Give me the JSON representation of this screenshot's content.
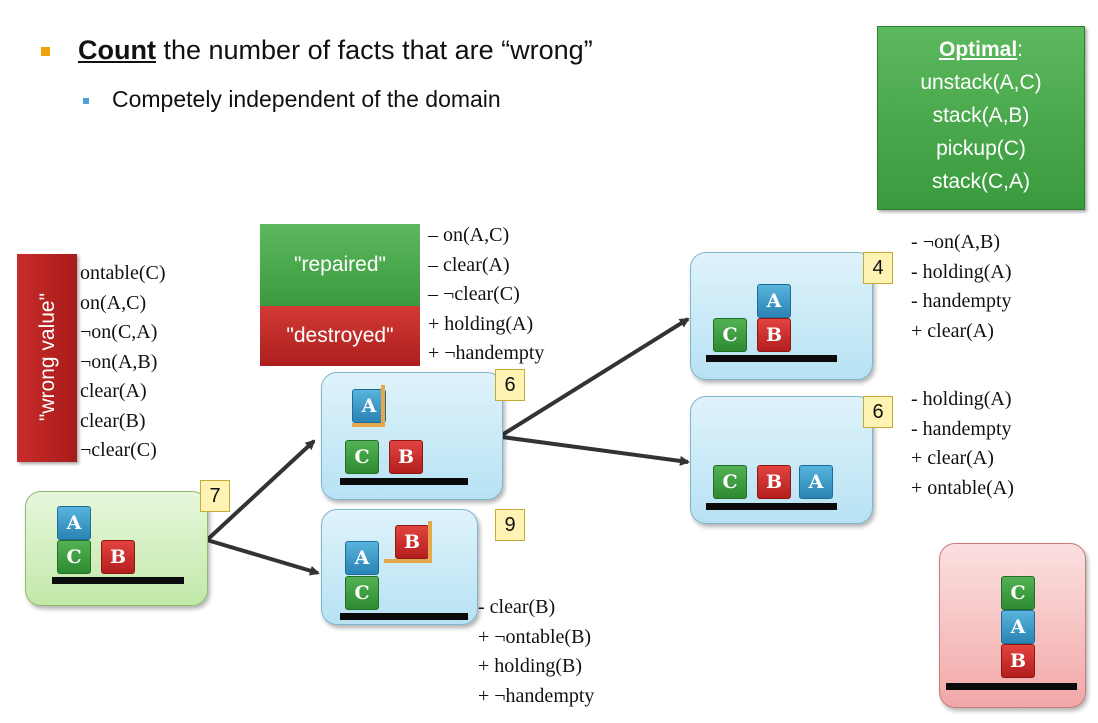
{
  "heading": {
    "bullet1_bold": "Count",
    "bullet1_rest": "the number of facts that are “wrong”",
    "bullet2": "Competely independent of the domain"
  },
  "optimal": {
    "title": "Optimal",
    "colon": ":",
    "steps": [
      "unstack(A,C)",
      "stack(A,B)",
      "pickup(C)",
      "stack(C,A)"
    ]
  },
  "wrong_value": {
    "label": "\"wrong value\"",
    "facts": [
      "ontable(C)",
      "on(A,C)",
      "¬on(C,A)",
      "¬on(A,B)",
      "clear(A)",
      "clear(B)",
      "¬clear(C)"
    ]
  },
  "legend": {
    "repaired": "\"repaired\"",
    "destroyed": "\"destroyed\"",
    "facts": [
      "– on(A,C)",
      "– clear(A)",
      "– ¬clear(C)",
      "+ holding(A)",
      "+ ¬handempty"
    ]
  },
  "states": {
    "initial": {
      "value": "7",
      "blocks": [
        "A",
        "C",
        "B"
      ]
    },
    "mid_top": {
      "value": "6",
      "blocks": [
        "A",
        "C",
        "B"
      ]
    },
    "mid_bottom": {
      "value": "9",
      "blocks": [
        "A",
        "C",
        "B"
      ],
      "facts": [
        "- clear(B)",
        "+ ¬ontable(B)",
        "+ holding(B)",
        "+ ¬handempty"
      ]
    },
    "right_top": {
      "value": "4",
      "blocks": [
        "A",
        "C",
        "B"
      ],
      "facts": [
        "- ¬on(A,B)",
        "- holding(A)",
        "- handempty",
        "+ clear(A)"
      ]
    },
    "right_bottom": {
      "value": "6",
      "blocks": [
        "C",
        "B",
        "A"
      ],
      "facts": [
        "- holding(A)",
        "- handempty",
        "+ clear(A)",
        "+ ontable(A)"
      ]
    },
    "goal": {
      "blocks": [
        "C",
        "A",
        "B"
      ]
    }
  },
  "colors": {
    "bullet_orange": "#f0a30a",
    "bullet_blue": "#4aa3d8",
    "green_box": "#4aa64d",
    "red_box": "#b82422",
    "number_tag": "#fff3b4",
    "state_blue": "#c9eaf7",
    "state_green": "#d4f0c1",
    "state_pink": "#f6c1c1"
  }
}
